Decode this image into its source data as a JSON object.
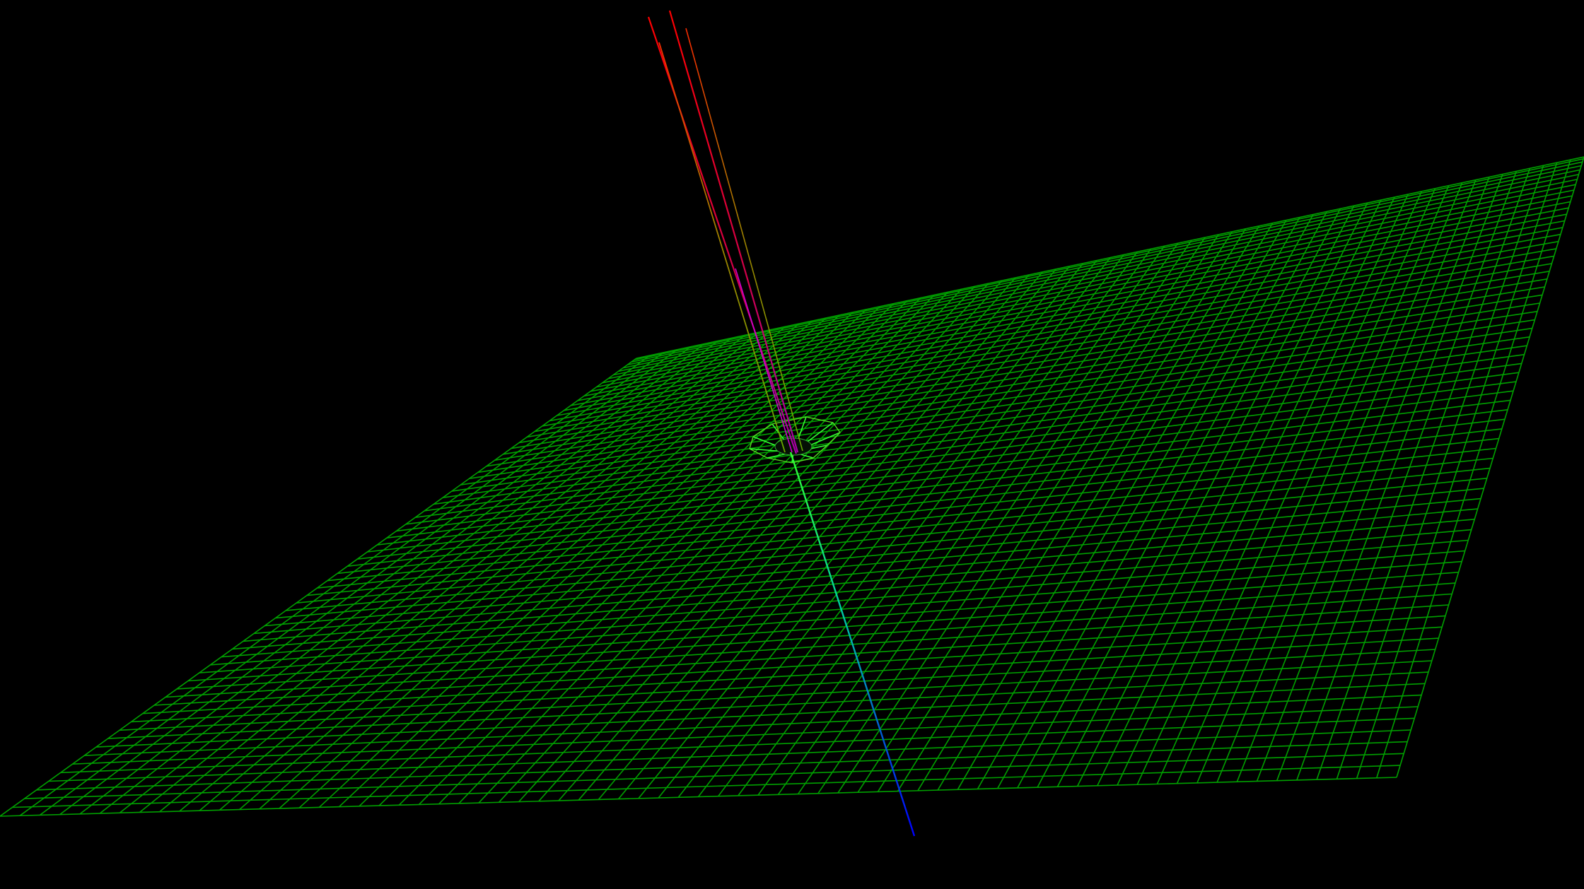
{
  "scene": {
    "background_color": "#000000",
    "surface": {
      "kind": "wireframe-plane",
      "line_color": "#00a000",
      "highlight_color": "#33ff33",
      "grid_divisions": 70
    },
    "axes": {
      "x_axis_color": "#ff0000",
      "y_axis_color": "#ffff00",
      "z_axis_color": "#0000ff",
      "mixed_color": "#cc00cc"
    }
  }
}
